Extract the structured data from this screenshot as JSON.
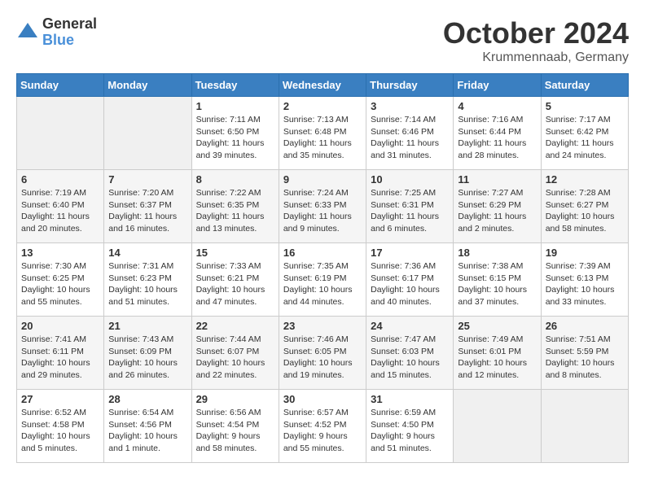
{
  "header": {
    "logo_line1": "General",
    "logo_line2": "Blue",
    "month": "October 2024",
    "location": "Krummennaab, Germany"
  },
  "weekdays": [
    "Sunday",
    "Monday",
    "Tuesday",
    "Wednesday",
    "Thursday",
    "Friday",
    "Saturday"
  ],
  "weeks": [
    [
      {
        "day": "",
        "info": ""
      },
      {
        "day": "",
        "info": ""
      },
      {
        "day": "1",
        "info": "Sunrise: 7:11 AM\nSunset: 6:50 PM\nDaylight: 11 hours and 39 minutes."
      },
      {
        "day": "2",
        "info": "Sunrise: 7:13 AM\nSunset: 6:48 PM\nDaylight: 11 hours and 35 minutes."
      },
      {
        "day": "3",
        "info": "Sunrise: 7:14 AM\nSunset: 6:46 PM\nDaylight: 11 hours and 31 minutes."
      },
      {
        "day": "4",
        "info": "Sunrise: 7:16 AM\nSunset: 6:44 PM\nDaylight: 11 hours and 28 minutes."
      },
      {
        "day": "5",
        "info": "Sunrise: 7:17 AM\nSunset: 6:42 PM\nDaylight: 11 hours and 24 minutes."
      }
    ],
    [
      {
        "day": "6",
        "info": "Sunrise: 7:19 AM\nSunset: 6:40 PM\nDaylight: 11 hours and 20 minutes."
      },
      {
        "day": "7",
        "info": "Sunrise: 7:20 AM\nSunset: 6:37 PM\nDaylight: 11 hours and 16 minutes."
      },
      {
        "day": "8",
        "info": "Sunrise: 7:22 AM\nSunset: 6:35 PM\nDaylight: 11 hours and 13 minutes."
      },
      {
        "day": "9",
        "info": "Sunrise: 7:24 AM\nSunset: 6:33 PM\nDaylight: 11 hours and 9 minutes."
      },
      {
        "day": "10",
        "info": "Sunrise: 7:25 AM\nSunset: 6:31 PM\nDaylight: 11 hours and 6 minutes."
      },
      {
        "day": "11",
        "info": "Sunrise: 7:27 AM\nSunset: 6:29 PM\nDaylight: 11 hours and 2 minutes."
      },
      {
        "day": "12",
        "info": "Sunrise: 7:28 AM\nSunset: 6:27 PM\nDaylight: 10 hours and 58 minutes."
      }
    ],
    [
      {
        "day": "13",
        "info": "Sunrise: 7:30 AM\nSunset: 6:25 PM\nDaylight: 10 hours and 55 minutes."
      },
      {
        "day": "14",
        "info": "Sunrise: 7:31 AM\nSunset: 6:23 PM\nDaylight: 10 hours and 51 minutes."
      },
      {
        "day": "15",
        "info": "Sunrise: 7:33 AM\nSunset: 6:21 PM\nDaylight: 10 hours and 47 minutes."
      },
      {
        "day": "16",
        "info": "Sunrise: 7:35 AM\nSunset: 6:19 PM\nDaylight: 10 hours and 44 minutes."
      },
      {
        "day": "17",
        "info": "Sunrise: 7:36 AM\nSunset: 6:17 PM\nDaylight: 10 hours and 40 minutes."
      },
      {
        "day": "18",
        "info": "Sunrise: 7:38 AM\nSunset: 6:15 PM\nDaylight: 10 hours and 37 minutes."
      },
      {
        "day": "19",
        "info": "Sunrise: 7:39 AM\nSunset: 6:13 PM\nDaylight: 10 hours and 33 minutes."
      }
    ],
    [
      {
        "day": "20",
        "info": "Sunrise: 7:41 AM\nSunset: 6:11 PM\nDaylight: 10 hours and 29 minutes."
      },
      {
        "day": "21",
        "info": "Sunrise: 7:43 AM\nSunset: 6:09 PM\nDaylight: 10 hours and 26 minutes."
      },
      {
        "day": "22",
        "info": "Sunrise: 7:44 AM\nSunset: 6:07 PM\nDaylight: 10 hours and 22 minutes."
      },
      {
        "day": "23",
        "info": "Sunrise: 7:46 AM\nSunset: 6:05 PM\nDaylight: 10 hours and 19 minutes."
      },
      {
        "day": "24",
        "info": "Sunrise: 7:47 AM\nSunset: 6:03 PM\nDaylight: 10 hours and 15 minutes."
      },
      {
        "day": "25",
        "info": "Sunrise: 7:49 AM\nSunset: 6:01 PM\nDaylight: 10 hours and 12 minutes."
      },
      {
        "day": "26",
        "info": "Sunrise: 7:51 AM\nSunset: 5:59 PM\nDaylight: 10 hours and 8 minutes."
      }
    ],
    [
      {
        "day": "27",
        "info": "Sunrise: 6:52 AM\nSunset: 4:58 PM\nDaylight: 10 hours and 5 minutes."
      },
      {
        "day": "28",
        "info": "Sunrise: 6:54 AM\nSunset: 4:56 PM\nDaylight: 10 hours and 1 minute."
      },
      {
        "day": "29",
        "info": "Sunrise: 6:56 AM\nSunset: 4:54 PM\nDaylight: 9 hours and 58 minutes."
      },
      {
        "day": "30",
        "info": "Sunrise: 6:57 AM\nSunset: 4:52 PM\nDaylight: 9 hours and 55 minutes."
      },
      {
        "day": "31",
        "info": "Sunrise: 6:59 AM\nSunset: 4:50 PM\nDaylight: 9 hours and 51 minutes."
      },
      {
        "day": "",
        "info": ""
      },
      {
        "day": "",
        "info": ""
      }
    ]
  ]
}
